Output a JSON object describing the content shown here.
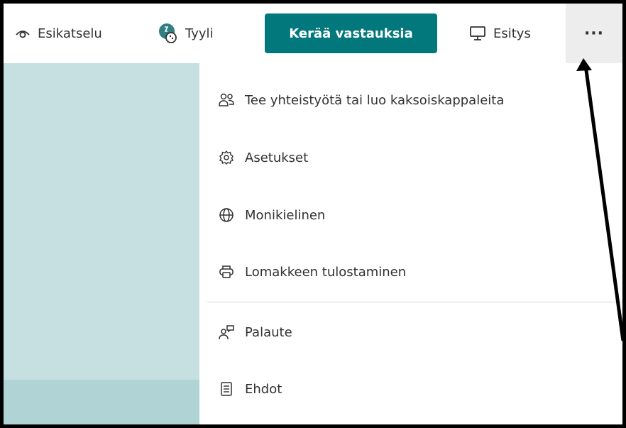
{
  "toolbar": {
    "preview_label": "Esikatselu",
    "style_label": "Tyyli",
    "collect_label": "Kerää vastauksia",
    "present_label": "Esitys",
    "more_label": "···"
  },
  "menu": {
    "items": [
      {
        "label": "Tee yhteistyötä tai luo kaksoiskappaleita",
        "icon": "people-icon"
      },
      {
        "label": "Asetukset",
        "icon": "gear-icon"
      },
      {
        "label": "Monikielinen",
        "icon": "globe-icon"
      },
      {
        "label": "Lomakkeen tulostaminen",
        "icon": "printer-icon"
      },
      {
        "label": "Palaute",
        "icon": "feedback-icon"
      },
      {
        "label": "Ehdot",
        "icon": "document-icon"
      }
    ]
  },
  "colors": {
    "accent": "#03787c",
    "left_panel": "#c6e0e1",
    "more_button_bg": "#ededed"
  }
}
